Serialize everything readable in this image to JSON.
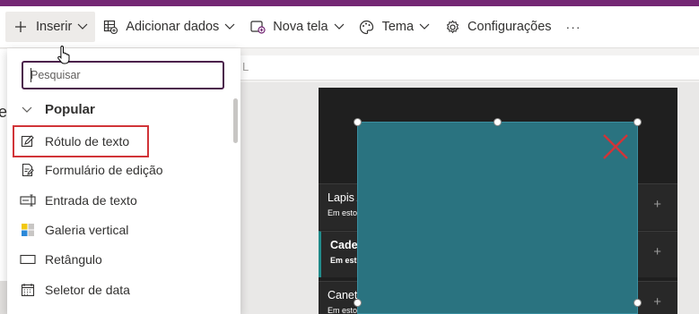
{
  "commandbar": {
    "insert_label": "Inserir",
    "add_data_label": "Adicionar dados",
    "new_screen_label": "Nova tela",
    "theme_label": "Tema",
    "settings_label": "Configurações",
    "more_label": "···"
  },
  "insert_panel": {
    "search_placeholder": "Pesquisar",
    "section_title": "Popular",
    "items": [
      {
        "label": "Rótulo de texto",
        "icon": "pencil-edit-icon",
        "highlighted": true
      },
      {
        "label": "Formulário de edição",
        "icon": "form-edit-icon"
      },
      {
        "label": "Entrada de texto",
        "icon": "text-input-icon"
      },
      {
        "label": "Galeria vertical",
        "icon": "gallery-icon"
      },
      {
        "label": "Retângulo",
        "icon": "rectangle-icon"
      },
      {
        "label": "Seletor de data",
        "icon": "calendar-icon"
      }
    ]
  },
  "studio": {
    "left_letter": "e",
    "formula_text": "L"
  },
  "app_preview": {
    "items": [
      {
        "name": "Lapis A",
        "sub": "Em esto"
      },
      {
        "name": "Cader",
        "sub": "Em esto"
      },
      {
        "name": "Canet",
        "sub": "Em esto"
      }
    ],
    "plus": "+"
  },
  "colors": {
    "brand": "#742774",
    "overlay": "#2a7380",
    "highlight_border": "#d13438",
    "close_x": "#d13438"
  }
}
